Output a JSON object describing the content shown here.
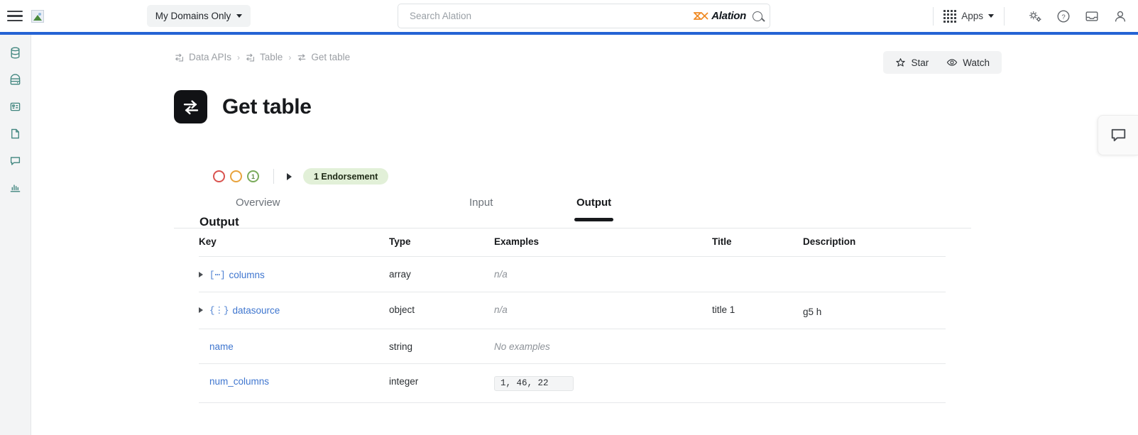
{
  "topbar": {
    "menu_icon": "hamburger-menu-icon",
    "logo_icon": "broken-image-icon",
    "domain_filter": {
      "label": "My Domains Only",
      "caret_icon": "chevron-down-icon"
    },
    "search": {
      "placeholder": "Search Alation",
      "value": "",
      "brand": "Alation",
      "brand_icon": "alation-logo-icon",
      "search_icon": "search-icon"
    },
    "apps": {
      "label": "Apps",
      "grid_icon": "apps-grid-icon",
      "caret_icon": "chevron-down-icon"
    },
    "icons": [
      {
        "name": "settings-gears-icon"
      },
      {
        "name": "help-question-icon"
      },
      {
        "name": "inbox-icon"
      },
      {
        "name": "user-profile-icon"
      }
    ],
    "accent_color": "#2563d4"
  },
  "rail": {
    "items": [
      {
        "name": "sidebar-item-data-sources",
        "icon": "database-icon"
      },
      {
        "name": "sidebar-item-storage",
        "icon": "server-icon"
      },
      {
        "name": "sidebar-item-tables",
        "icon": "table-grid-icon"
      },
      {
        "name": "sidebar-item-documents",
        "icon": "document-icon"
      },
      {
        "name": "sidebar-item-conversations",
        "icon": "chat-bubble-icon"
      },
      {
        "name": "sidebar-item-analytics",
        "icon": "bar-chart-icon"
      }
    ],
    "icon_color": "#3f857e"
  },
  "breadcrumb": {
    "items": [
      {
        "label": "Data APIs",
        "icon": "api-exchange-icon"
      },
      {
        "label": "Table",
        "icon": "api-exchange-icon"
      },
      {
        "label": "Get table",
        "icon": "arrows-exchange-icon"
      }
    ],
    "separator": "›"
  },
  "actions": {
    "star": {
      "label": "Star",
      "icon": "star-icon"
    },
    "watch": {
      "label": "Watch",
      "icon": "eye-icon"
    }
  },
  "page": {
    "title": "Get table",
    "logo_icon": "arrows-exchange-icon"
  },
  "quality": {
    "indicators": [
      {
        "name": "quality-flag-red",
        "value": "",
        "color": "#d9534f"
      },
      {
        "name": "quality-flag-amber",
        "value": "",
        "color": "#e8a33d"
      },
      {
        "name": "quality-flag-green",
        "value": "1",
        "color": "#7aab5b"
      }
    ],
    "expand_icon": "triangle-right-icon",
    "endorsement": "1 Endorsement",
    "endorsement_color": "#e2f0d8"
  },
  "tabs": [
    {
      "label": "Overview",
      "active": false
    },
    {
      "label": "Input",
      "active": false
    },
    {
      "label": "Output",
      "active": true
    }
  ],
  "output": {
    "heading": "Output",
    "columns": [
      "Key",
      "Type",
      "Examples",
      "Title",
      "Description"
    ],
    "rows": [
      {
        "expandable": true,
        "type_glyph": "[⋯]",
        "key": "columns",
        "type": "array",
        "examples": "n/a",
        "examples_style": "italic",
        "title": "",
        "description": ""
      },
      {
        "expandable": true,
        "type_glyph": "{⋮}",
        "key": "datasource",
        "type": "object",
        "examples": "n/a",
        "examples_style": "italic",
        "title": "title 1",
        "description": "g5 h"
      },
      {
        "expandable": false,
        "type_glyph": "",
        "key": "name",
        "type": "string",
        "examples": "No examples",
        "examples_style": "italic",
        "title": "",
        "description": ""
      },
      {
        "expandable": false,
        "type_glyph": "",
        "key": "num_columns",
        "type": "integer",
        "examples": "1, 46, 22",
        "examples_style": "code",
        "title": "",
        "description": ""
      }
    ]
  },
  "feedback": {
    "icon": "chat-bubble-icon"
  }
}
